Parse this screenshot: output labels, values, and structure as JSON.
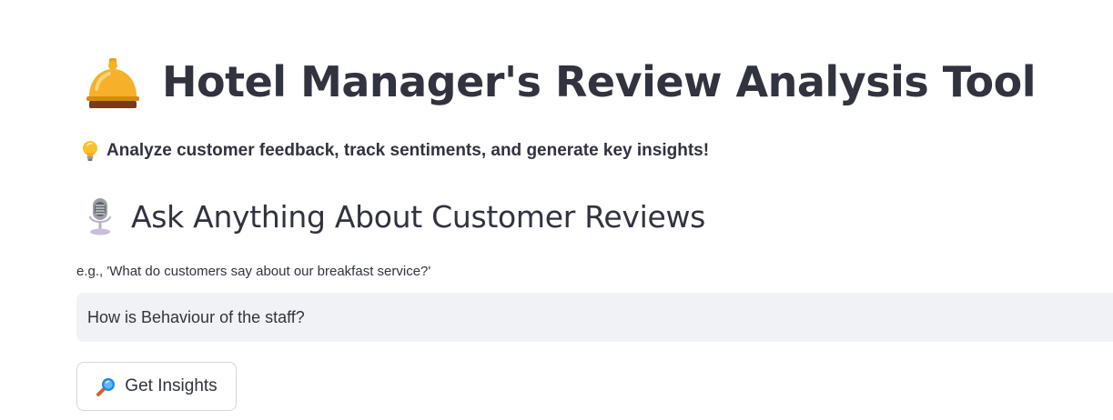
{
  "header": {
    "icon": "bellhop-bell-icon",
    "title": "Hotel Manager's Review Analysis Tool"
  },
  "tagline": {
    "icon": "light-bulb-icon",
    "text": "Analyze customer feedback, track sentiments, and generate key insights!"
  },
  "section": {
    "icon": "studio-microphone-icon",
    "title": "Ask Anything About Customer Reviews"
  },
  "query": {
    "label": "e.g., 'What do customers say about our breakfast service?'",
    "value": "How is Behaviour of the staff?"
  },
  "action": {
    "icon": "magnifying-glass-icon",
    "label": "Get Insights"
  },
  "colors": {
    "text": "#31333f",
    "input_background": "#f0f2f6",
    "button_border": "#d6d6d9"
  }
}
